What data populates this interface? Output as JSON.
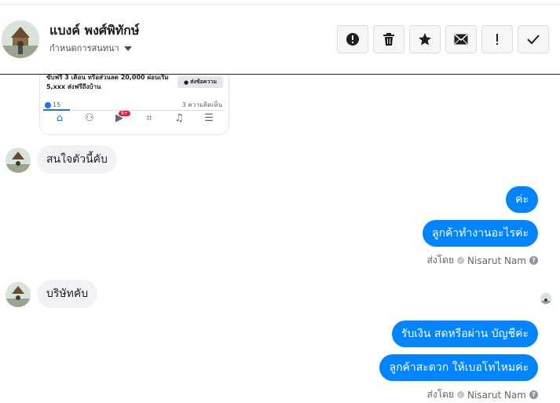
{
  "contact": {
    "name": "แบงค์ พงศ์พิทักษ์",
    "subtitle": "กำหนดการสนทนา"
  },
  "toolbar": {
    "buttons": [
      {
        "icon": "alert-circle-icon",
        "glyph": "●"
      },
      {
        "icon": "trash-icon",
        "glyph": "🗑"
      },
      {
        "icon": "star-icon",
        "glyph": "★"
      },
      {
        "icon": "envelope-icon",
        "glyph": "✉"
      },
      {
        "icon": "exclamation-icon",
        "glyph": "!"
      },
      {
        "icon": "check-icon",
        "glyph": "✓"
      }
    ]
  },
  "shared_post": {
    "promo_text": "ขับฟรี 3 เดือน หรือส่วนลด 20,000 ผ่อนเริ่ม 5,xxx ส่งฟรีถึงบ้าน",
    "button_label": "ส่งข้อความ",
    "like_count": "15",
    "comments": "3 ความคิดเห็น",
    "badge": "9+"
  },
  "messages": {
    "m1": "สนใจตัวนี้คับ",
    "m2": "ค่ะ",
    "m3": "ลูกค้าทำงานอะไรค่ะ",
    "m4": "บริษัทคับ",
    "m5": "รับเงิน สดหรือผ่าน บัญชีค่ะ",
    "m6": "ลูกค้าสะดวก ให้เบอโทไหมค่ะ"
  },
  "sent_by": {
    "label": "ส่งโดย",
    "agent": "Nisarut Nam"
  },
  "colors": {
    "outgoing": "#0084ff",
    "incoming": "#f0f2f5"
  }
}
